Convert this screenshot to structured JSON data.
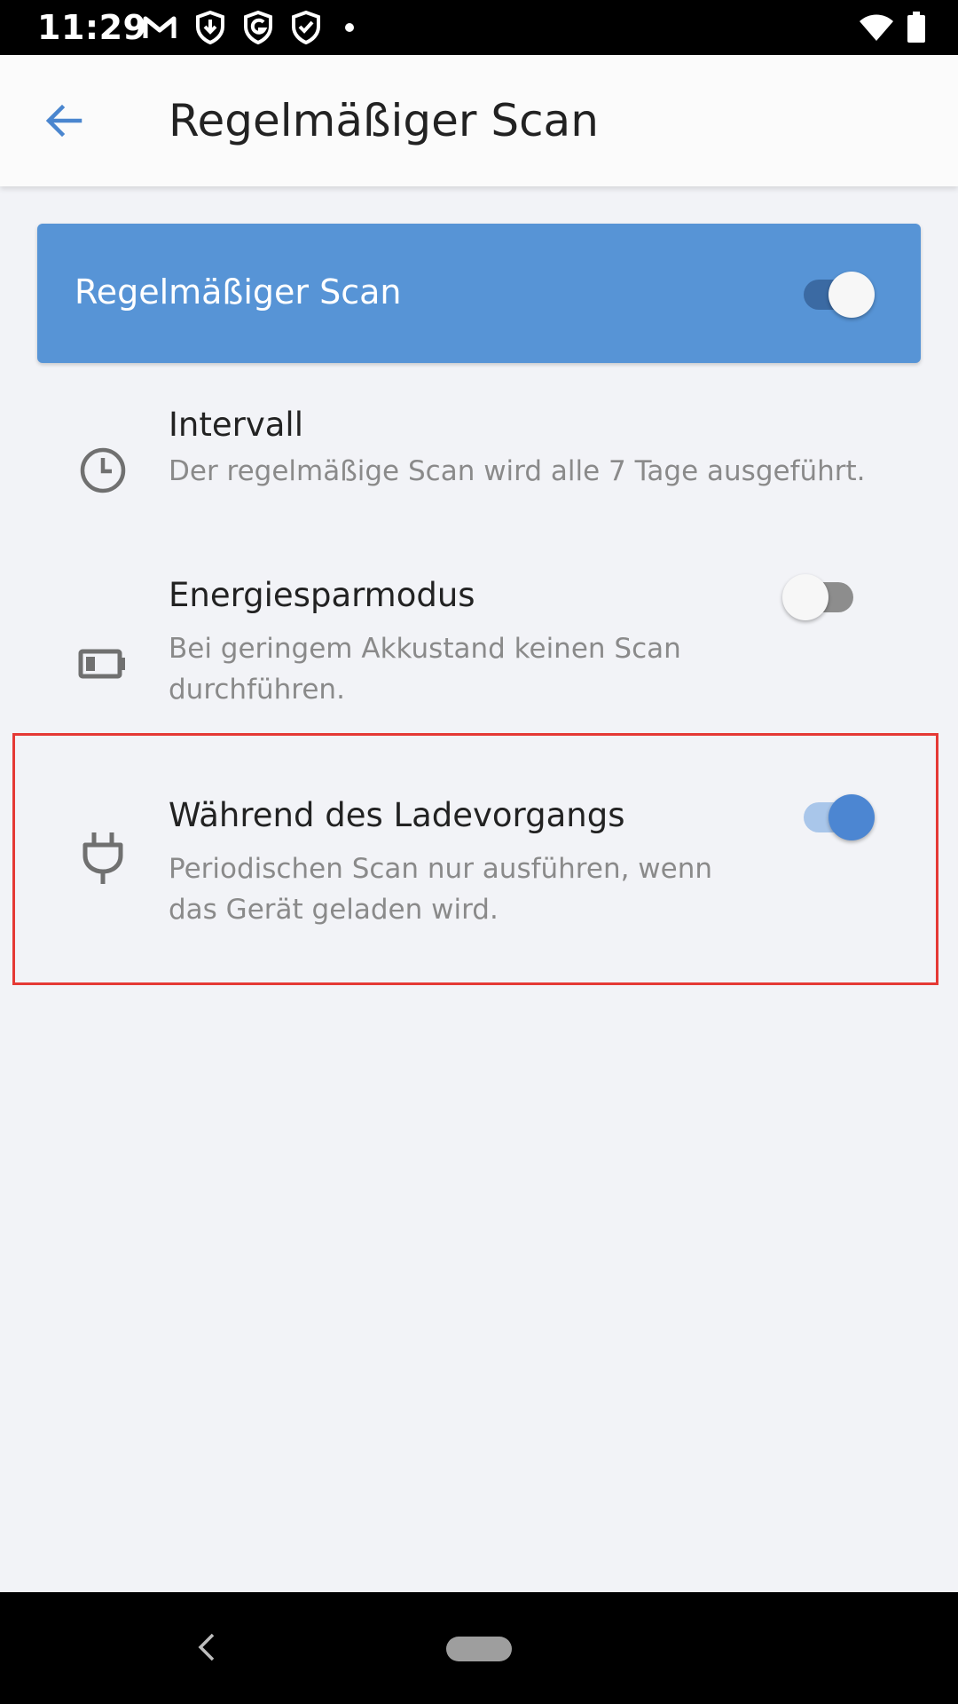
{
  "status_bar": {
    "time": "11:29",
    "notification_icons": [
      "gmail-icon",
      "download-shield-icon",
      "g-shield-icon",
      "check-shield-icon",
      "more-notifications-dot"
    ],
    "system_icons": [
      "wifi-icon",
      "battery-icon"
    ]
  },
  "app_bar": {
    "back_icon": "arrow-left-icon",
    "title": "Regelmäßiger Scan"
  },
  "main_toggle": {
    "label": "Regelmäßiger Scan",
    "enabled": true
  },
  "settings": [
    {
      "icon": "clock-icon",
      "title": "Intervall",
      "description": "Der regelmäßige Scan wird alle 7 Tage ausgeführt."
    },
    {
      "icon": "battery-low-icon",
      "title": "Energiesparmodus",
      "description": "Bei geringem Akkustand keinen Scan durchführen.",
      "enabled": false
    },
    {
      "icon": "power-plug-icon",
      "title": "Während des Ladevorgangs",
      "description": "Periodischen Scan nur ausführen, wenn das Gerät geladen wird.",
      "enabled": true
    }
  ],
  "colors": {
    "accent": "#5794d6",
    "highlight": "#e53935",
    "background": "#f2f3f7"
  },
  "nav_bar": {
    "buttons": [
      "back-icon",
      "home-pill"
    ]
  }
}
